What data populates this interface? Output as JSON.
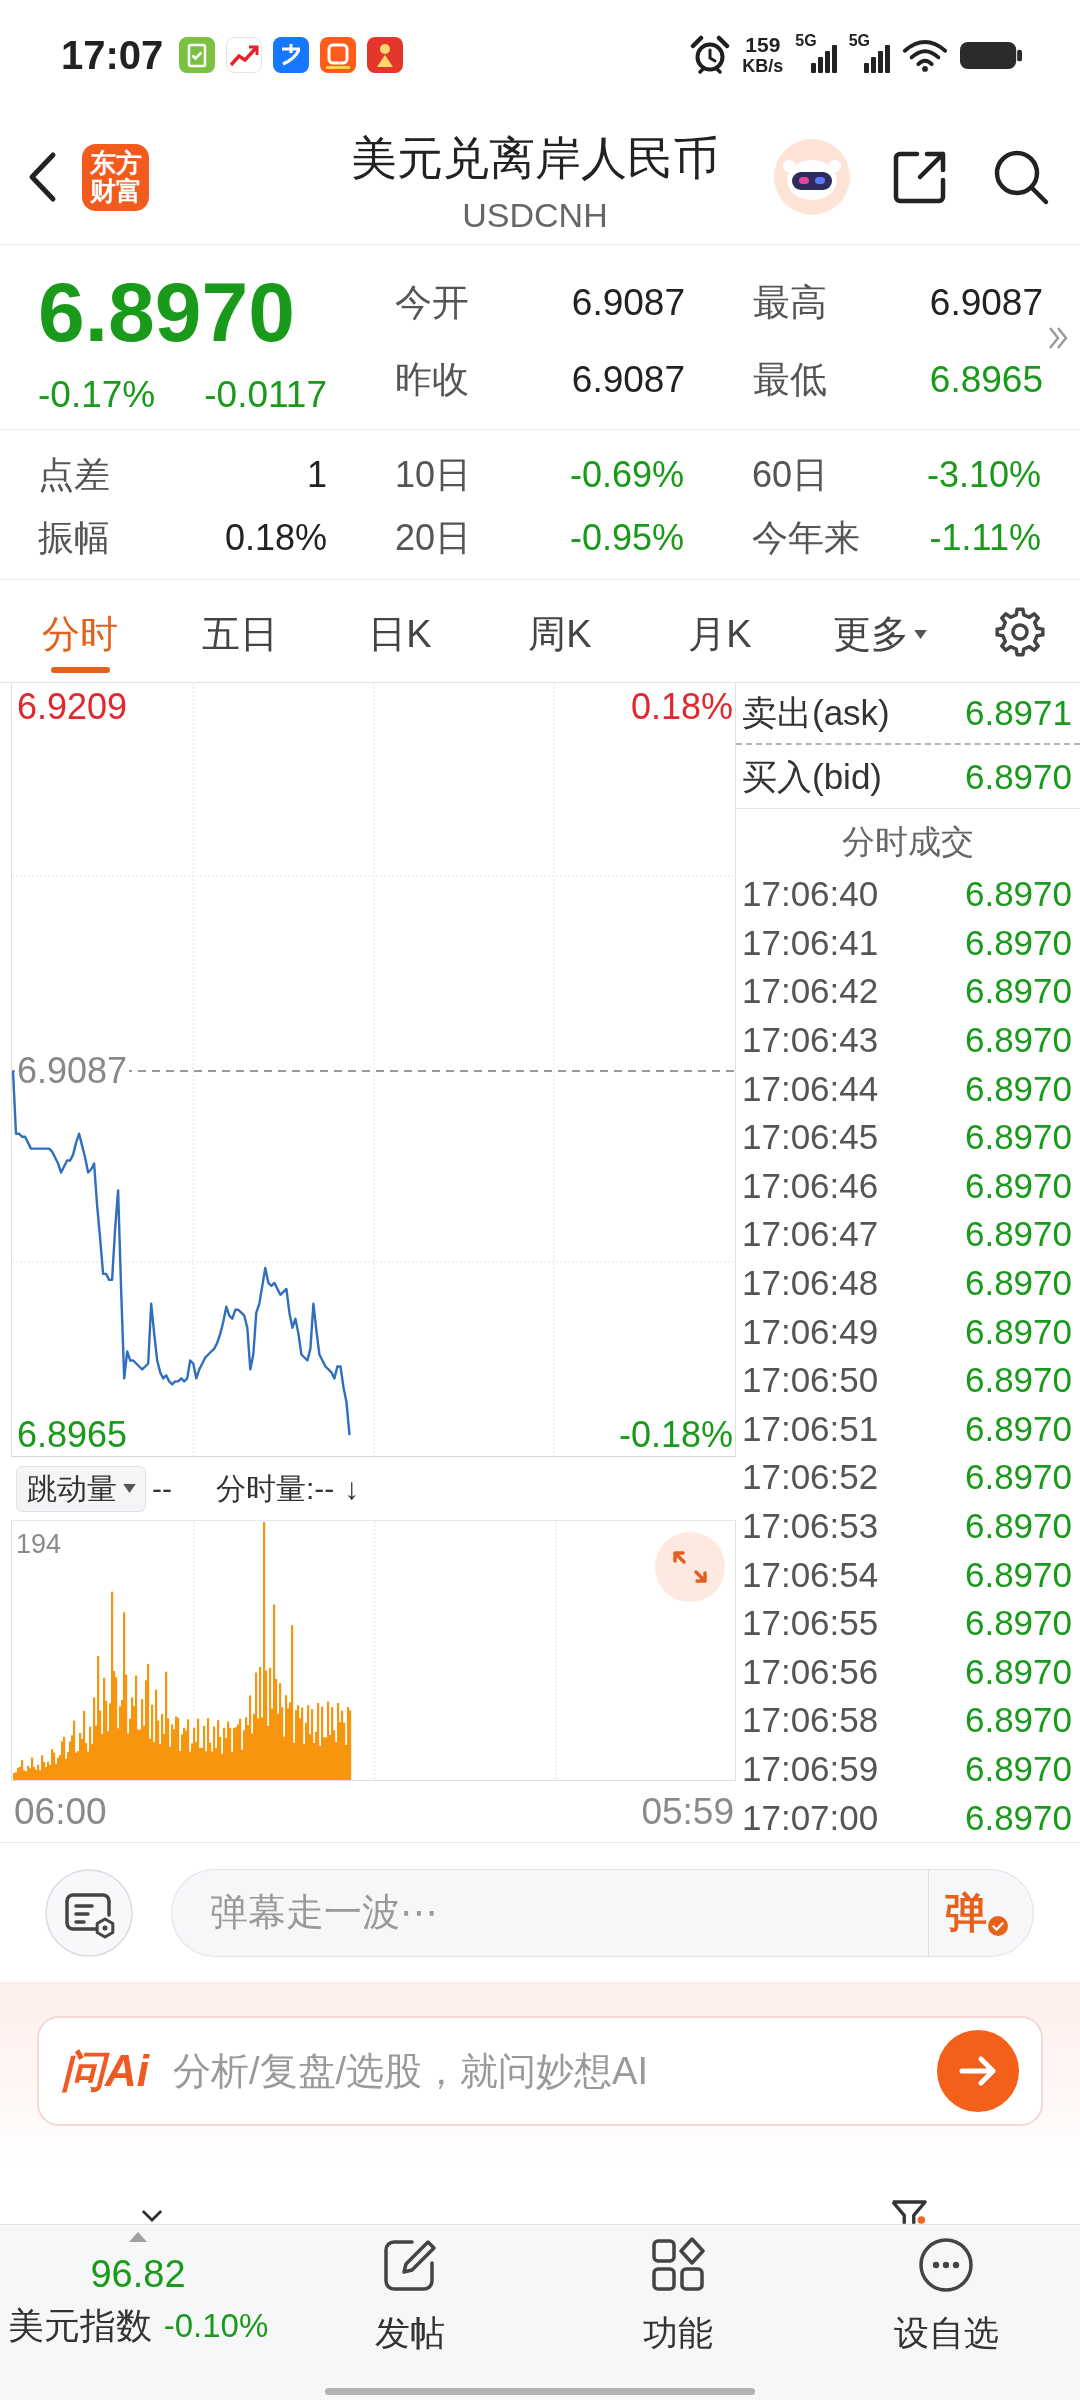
{
  "status_bar": {
    "time": "17:07",
    "speed": "159",
    "speed_unit": "KB/s",
    "networks": [
      "5G",
      "5G"
    ]
  },
  "header": {
    "logo": "东方财富",
    "title": "美元兑离岸人民币",
    "code": "USDCNH"
  },
  "quote": {
    "price": "6.8970",
    "falling": true,
    "change_pct": "-0.17%",
    "change": "-0.0117",
    "fields": [
      {
        "label": "今开",
        "value": "6.9087",
        "color": "#222222"
      },
      {
        "label": "最高",
        "value": "6.9087",
        "color": "#222222"
      },
      {
        "label": "昨收",
        "value": "6.9087",
        "color": "#222222"
      },
      {
        "label": "最低",
        "value": "6.8965",
        "color": "#1a9a1a"
      }
    ],
    "stats": [
      {
        "label": "点差",
        "value": "1",
        "color": "#222222"
      },
      {
        "label": "10日",
        "value": "-0.69%",
        "color": "#1a9a1a"
      },
      {
        "label": "60日",
        "value": "-3.10%",
        "color": "#1a9a1a"
      },
      {
        "label": "振幅",
        "value": "0.18%",
        "color": "#222222"
      },
      {
        "label": "20日",
        "value": "-0.95%",
        "color": "#1a9a1a"
      },
      {
        "label": "今年来",
        "value": "-1.11%",
        "color": "#1a9a1a"
      }
    ]
  },
  "tabs": [
    {
      "label": "分时",
      "kind": "tab",
      "selected": true
    },
    {
      "label": "五日",
      "kind": "tab",
      "selected": false
    },
    {
      "label": "日K",
      "kind": "tab",
      "selected": false
    },
    {
      "label": "周K",
      "kind": "tab",
      "selected": false
    },
    {
      "label": "月K",
      "kind": "tab",
      "selected": false
    },
    {
      "label": "更多",
      "kind": "menu",
      "selected": false
    }
  ],
  "chart": {
    "price": {
      "chart_data": {
        "type": "line",
        "categories": [
          null,
          null,
          null,
          null,
          null,
          null,
          null,
          null,
          null,
          null,
          null,
          null,
          null,
          null,
          null,
          null,
          null,
          null,
          null,
          null,
          null,
          null,
          null,
          null,
          null,
          null,
          null,
          null,
          null,
          null,
          null,
          null,
          null,
          null,
          null,
          null,
          null,
          null,
          null,
          null,
          null,
          null,
          null,
          null,
          null,
          null,
          null,
          null,
          null,
          null,
          null,
          null,
          null,
          null,
          null,
          null,
          null,
          null,
          null,
          null,
          null,
          null,
          null,
          null,
          null,
          null,
          null,
          null,
          null,
          null,
          null,
          null,
          null,
          null,
          null,
          null,
          null,
          null,
          null,
          null,
          null,
          null,
          null,
          null,
          null,
          null,
          null,
          null,
          null,
          null,
          null,
          null,
          null,
          null,
          null,
          null,
          null,
          null,
          null,
          null,
          null,
          null,
          null,
          null,
          null,
          null,
          null,
          null,
          null,
          null,
          null,
          null,
          null,
          null,
          null,
          null,
          null,
          null,
          null,
          null,
          null,
          null,
          null,
          null,
          null,
          null,
          null,
          null,
          null,
          null,
          null,
          null,
          null,
          null,
          null,
          null,
          null,
          null,
          null,
          null,
          null,
          null,
          null,
          null,
          null,
          null,
          null,
          null,
          null,
          null,
          null,
          null,
          null,
          null,
          null,
          null,
          null,
          null,
          null,
          null,
          null,
          null,
          null,
          null,
          null,
          null,
          null,
          null,
          null,
          null,
          null,
          null,
          null,
          null,
          null,
          null,
          null,
          null,
          null,
          null,
          null,
          null,
          null,
          null,
          null,
          null,
          null,
          null,
          null,
          null,
          null,
          null,
          null,
          null,
          null,
          null,
          null,
          null,
          null,
          null,
          null,
          null,
          null,
          null,
          null,
          null,
          null,
          null,
          null,
          null,
          null,
          null,
          null,
          null,
          null,
          null,
          null,
          null,
          null,
          null,
          null,
          null,
          null,
          null,
          null,
          null,
          null,
          null,
          null,
          null,
          null,
          null,
          null,
          null,
          null,
          null,
          null,
          null,
          null,
          null,
          null
        ],
        "values": [
          6.9087,
          6.9066,
          6.9066,
          6.9065,
          6.9065,
          6.9063,
          6.9061,
          6.9061,
          6.9061,
          6.9061,
          6.9061,
          6.9061,
          6.9061,
          6.906,
          6.9058,
          6.9056,
          6.9053,
          6.9055,
          6.9057,
          6.9057,
          6.9059,
          6.9063,
          6.9066,
          6.9062,
          6.9058,
          6.9053,
          6.9054,
          6.9056,
          6.9042,
          6.9031,
          6.9019,
          6.9019,
          6.9017,
          6.9017,
          6.9034,
          6.9047,
          6.9014,
          6.8984,
          6.8993,
          6.899,
          6.899,
          6.8989,
          6.8988,
          6.8987,
          6.8988,
          6.8989,
          6.9009,
          6.8999,
          6.899,
          6.8986,
          6.8984,
          6.8985,
          6.8983,
          6.8982,
          6.8983,
          6.8983,
          6.8984,
          6.8983,
          6.8984,
          6.899,
          6.8989,
          6.8984,
          6.8987,
          6.8989,
          6.8991,
          6.8992,
          6.8993,
          6.8994,
          6.8996,
          6.8999,
          6.9003,
          6.9008,
          6.9005,
          6.9004,
          6.9007,
          6.9007,
          6.9006,
          6.9005,
          6.9001,
          6.8987,
          6.8992,
          6.9006,
          6.9009,
          6.9015,
          6.9021,
          6.9016,
          6.9015,
          6.9016,
          6.9014,
          6.9012,
          6.9013,
          6.9014,
          6.9006,
          6.9001,
          6.9004,
          6.8999,
          6.8992,
          6.8991,
          6.899,
          6.8994,
          6.9009,
          6.9,
          6.8992,
          6.899,
          6.8988,
          6.8987,
          6.8986,
          6.8984,
          6.8988,
          6.8988,
          6.8981,
          6.8976,
          6.8965,
          null,
          null,
          null,
          null,
          null,
          null,
          null,
          null,
          null,
          null,
          null,
          null,
          null,
          null,
          null,
          null,
          null,
          null,
          null,
          null,
          null,
          null,
          null,
          null,
          null,
          null,
          null,
          null,
          null,
          null,
          null,
          null,
          null,
          null,
          null,
          null,
          null,
          null,
          null,
          null,
          null,
          null,
          null,
          null,
          null,
          null,
          null,
          null,
          null,
          null,
          null,
          null,
          null,
          null,
          null,
          null,
          null,
          null,
          null,
          null,
          null,
          null,
          null,
          null,
          null,
          null,
          null,
          null,
          null,
          null,
          null,
          null,
          null,
          null,
          null,
          null,
          null,
          null,
          null,
          null,
          null,
          null,
          null,
          null,
          null,
          null,
          null,
          null,
          null,
          null,
          null,
          null,
          null,
          null,
          null,
          null,
          null,
          null,
          null,
          null,
          null,
          null,
          null,
          null,
          null,
          null,
          null,
          null,
          null,
          null,
          null,
          null,
          null,
          null,
          null,
          null,
          null,
          null,
          null,
          null,
          null,
          null,
          null,
          null,
          null,
          null,
          null,
          null
        ],
        "ylim": [
          6.8958,
          6.9217
        ],
        "yticks": [
          {
            "value": 6.9209,
            "label": "6.9209"
          },
          {
            "value": 6.9087,
            "label": "6.9087"
          },
          {
            "value": 6.8965,
            "label": "6.8965"
          }
        ],
        "ref_lines": [
          {
            "axis": "y",
            "value": 6.9087
          }
        ]
      },
      "percent_labels": [
        {
          "text": "0.18%",
          "color": "#e0282e"
        },
        {
          "text": "-0.18%",
          "color": "#1a9a1a"
        }
      ],
      "time_labels": [
        "06:00",
        "05:59"
      ]
    },
    "volume": {
      "selector": "跳动量",
      "selector_value": "--",
      "label": "分时量:--",
      "sort_arrow": "↓",
      "max_label": "194"
    }
  },
  "quote_panel": {
    "ask_label": "卖出(ask)",
    "ask": "6.8971",
    "bid_label": "买入(bid)",
    "bid": "6.8970",
    "trades_title": "分时成交",
    "trades": [
      {
        "time": "17:06:40",
        "price": "6.8970"
      },
      {
        "time": "17:06:41",
        "price": "6.8970"
      },
      {
        "time": "17:06:42",
        "price": "6.8970"
      },
      {
        "time": "17:06:43",
        "price": "6.8970"
      },
      {
        "time": "17:06:44",
        "price": "6.8970"
      },
      {
        "time": "17:06:45",
        "price": "6.8970"
      },
      {
        "time": "17:06:46",
        "price": "6.8970"
      },
      {
        "time": "17:06:47",
        "price": "6.8970"
      },
      {
        "time": "17:06:48",
        "price": "6.8970"
      },
      {
        "time": "17:06:49",
        "price": "6.8970"
      },
      {
        "time": "17:06:50",
        "price": "6.8970"
      },
      {
        "time": "17:06:51",
        "price": "6.8970"
      },
      {
        "time": "17:06:52",
        "price": "6.8970"
      },
      {
        "time": "17:06:53",
        "price": "6.8970"
      },
      {
        "time": "17:06:54",
        "price": "6.8970"
      },
      {
        "time": "17:06:55",
        "price": "6.8970"
      },
      {
        "time": "17:06:56",
        "price": "6.8970"
      },
      {
        "time": "17:06:58",
        "price": "6.8970"
      },
      {
        "time": "17:06:59",
        "price": "6.8970"
      },
      {
        "time": "17:07:00",
        "price": "6.8970"
      }
    ]
  },
  "comment_bar": {
    "placeholder": "弹幕走一波⋯",
    "send": "弹"
  },
  "ai_bar": {
    "logo": "问Ai",
    "placeholder": "分析/复盘/选股，就问妙想AI"
  },
  "bottom_nav": {
    "index": {
      "value": "96.82",
      "name": "美元指数",
      "change": "-0.10%",
      "falling": true
    },
    "items": [
      {
        "label": "发帖",
        "kind": "post"
      },
      {
        "label": "功能",
        "kind": "tools"
      },
      {
        "label": "设自选",
        "kind": "watchlist"
      }
    ]
  }
}
